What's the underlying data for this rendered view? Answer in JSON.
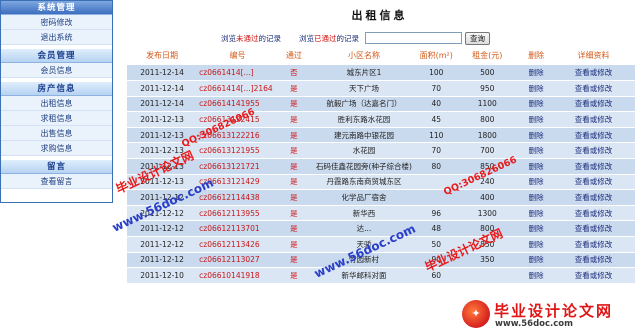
{
  "sidebar": {
    "groups": [
      {
        "title": "系统管理",
        "items": [
          "密码修改",
          "退出系统"
        ]
      },
      {
        "title": "会员管理",
        "items": [
          "会员信息"
        ]
      },
      {
        "title": "房产信息",
        "items": [
          "出租信息",
          "求租信息",
          "出售信息",
          "求购信息"
        ]
      },
      {
        "title": "留言",
        "items": [
          "查看留言"
        ]
      }
    ]
  },
  "main": {
    "title": "出租信息",
    "filter_unpassed": {
      "prefix": "浏览",
      "highlight": "未通过",
      "suffix": "的记录"
    },
    "filter_passed": {
      "prefix": "浏览",
      "highlight": "已通过",
      "suffix": "的记录"
    },
    "search_value": "",
    "search_label": "查询"
  },
  "table": {
    "headers": [
      "发布日期",
      "编号",
      "通过",
      "小区名称",
      "面积(m²)",
      "租金(元)",
      "删除",
      "详细资料"
    ],
    "rows": [
      [
        "2011-12-14",
        "cz0661414[...]",
        "否",
        "城东片区1",
        "100",
        "500",
        "删除",
        "查看或修改"
      ],
      [
        "2011-12-14",
        "cz0661414[...]2164",
        "是",
        "天下广场",
        "70",
        "950",
        "删除",
        "查看或修改"
      ],
      [
        "2011-12-14",
        "cz06614141955",
        "是",
        "航毅广场（达嘉名门）",
        "40",
        "1100",
        "删除",
        "查看或修改"
      ],
      [
        "2011-12-13",
        "cz06613122415",
        "是",
        "胜利东路水花园",
        "45",
        "800",
        "删除",
        "查看或修改"
      ],
      [
        "2011-12-13",
        "cz06613122216",
        "是",
        "建元南路中银花园",
        "110",
        "1800",
        "删除",
        "查看或修改"
      ],
      [
        "2011-12-13",
        "cz06613121955",
        "是",
        "水花园",
        "70",
        "700",
        "删除",
        "查看或修改"
      ],
      [
        "2011-12-13",
        "cz06613121721",
        "是",
        "石码佳鑫花园旁(种子综合楼)",
        "80",
        "850",
        "删除",
        "查看或修改"
      ],
      [
        "2011-12-13",
        "cz06613121429",
        "是",
        "丹霞路东南商贸城东区",
        "",
        "240",
        "删除",
        "查看或修改"
      ],
      [
        "2011-12-12",
        "cz06612114438",
        "是",
        "化学品厂宿舍",
        "",
        "400",
        "删除",
        "查看或修改"
      ],
      [
        "2011-12-12",
        "cz06612113955",
        "是",
        "新华西",
        "96",
        "1300",
        "删除",
        "查看或修改"
      ],
      [
        "2011-12-12",
        "cz06612113701",
        "是",
        "达...",
        "48",
        "800",
        "删除",
        "查看或修改"
      ],
      [
        "2011-12-12",
        "cz06612113426",
        "是",
        "天骄",
        "50",
        "850",
        "删除",
        "查看或修改"
      ],
      [
        "2011-12-12",
        "cz06612113027",
        "是",
        "竹园新村",
        "90",
        "350",
        "删除",
        "查看或修改"
      ],
      [
        "2011-12-10",
        "cz06610141918",
        "是",
        "新华邮科对面",
        "60",
        "",
        "删除",
        "查看或修改"
      ]
    ]
  },
  "watermark": {
    "site_a": "www.56doc.com",
    "site_b": "www.56doc.com",
    "qq_a": "QQ:306826066",
    "qq_b": "QQ:306826066",
    "brand_a": "毕业设计论文网",
    "brand_b": "毕业设计论文网",
    "logo_text": "毕业设计论文网",
    "logo_url": "www.56doc.com"
  }
}
